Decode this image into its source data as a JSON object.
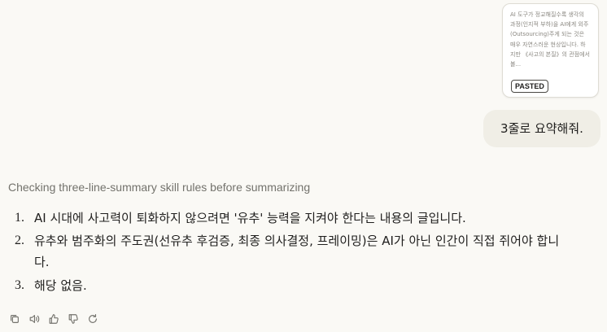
{
  "pasted": {
    "preview_text": "AI 도구가 정교해질수록 생각의 과정(인지적 부하)을 AI에게 외주(Outsourcing)주게 되는 것은 매우 자연스러운 현상입니다. 하지만 《사고의 본질》의 관점에서 볼...",
    "badge_label": "PASTED"
  },
  "user_message": {
    "text": "3줄로 요약해줘."
  },
  "assistant": {
    "status": "Checking three-line-summary skill rules before summarizing",
    "items": [
      {
        "num": "1.",
        "text": "AI 시대에 사고력이 퇴화하지 않으려면 '유추' 능력을 지켜야 한다는 내용의 글입니다."
      },
      {
        "num": "2.",
        "text": "유추와 범주화의 주도권(선유추 후검증, 최종 의사결정, 프레이밍)은 AI가 아닌 인간이 직접 쥐어야 합니다."
      },
      {
        "num": "3.",
        "text": "해당 없음."
      }
    ]
  },
  "actions": {
    "icons": [
      "copy-icon",
      "speaker-icon",
      "thumbs-up-icon",
      "thumbs-down-icon",
      "retry-icon"
    ]
  }
}
